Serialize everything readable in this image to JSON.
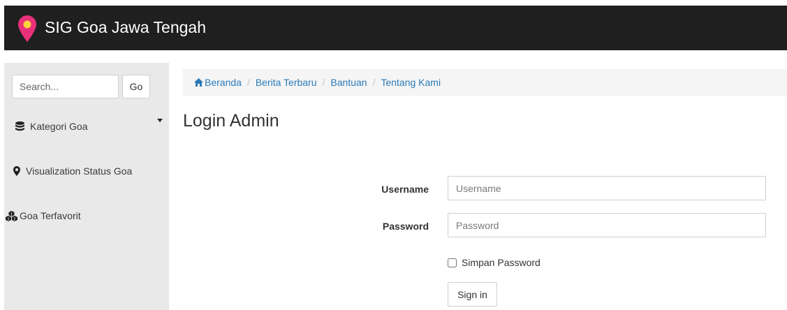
{
  "navbar": {
    "brand": "SIG Goa Jawa Tengah"
  },
  "sidebar": {
    "search": {
      "placeholder": "Search...",
      "value": "",
      "go_label": "Go"
    },
    "items": [
      {
        "label": "Kategori Goa",
        "icon": "database-icon"
      },
      {
        "label": "Visualization Status Goa",
        "icon": "map-marker-icon"
      },
      {
        "label": "Goa Terfavorit",
        "icon": "cubes-icon"
      }
    ]
  },
  "breadcrumb": [
    {
      "label": "Beranda",
      "icon": "home-icon"
    },
    {
      "label": "Berita Terbaru"
    },
    {
      "label": "Bantuan"
    },
    {
      "label": "Tentang Kami"
    }
  ],
  "page": {
    "title": "Login Admin"
  },
  "form": {
    "username": {
      "label": "Username",
      "placeholder": "Username",
      "value": ""
    },
    "password": {
      "label": "Password",
      "placeholder": "Password",
      "value": ""
    },
    "remember_label": "Simpan Password",
    "remember_checked": false,
    "submit_label": "Sign in"
  },
  "colors": {
    "navbar": "#1f1f1f",
    "pin": "#e8317a",
    "link": "#2a7ab8",
    "sidebar": "#e9e9e9"
  }
}
